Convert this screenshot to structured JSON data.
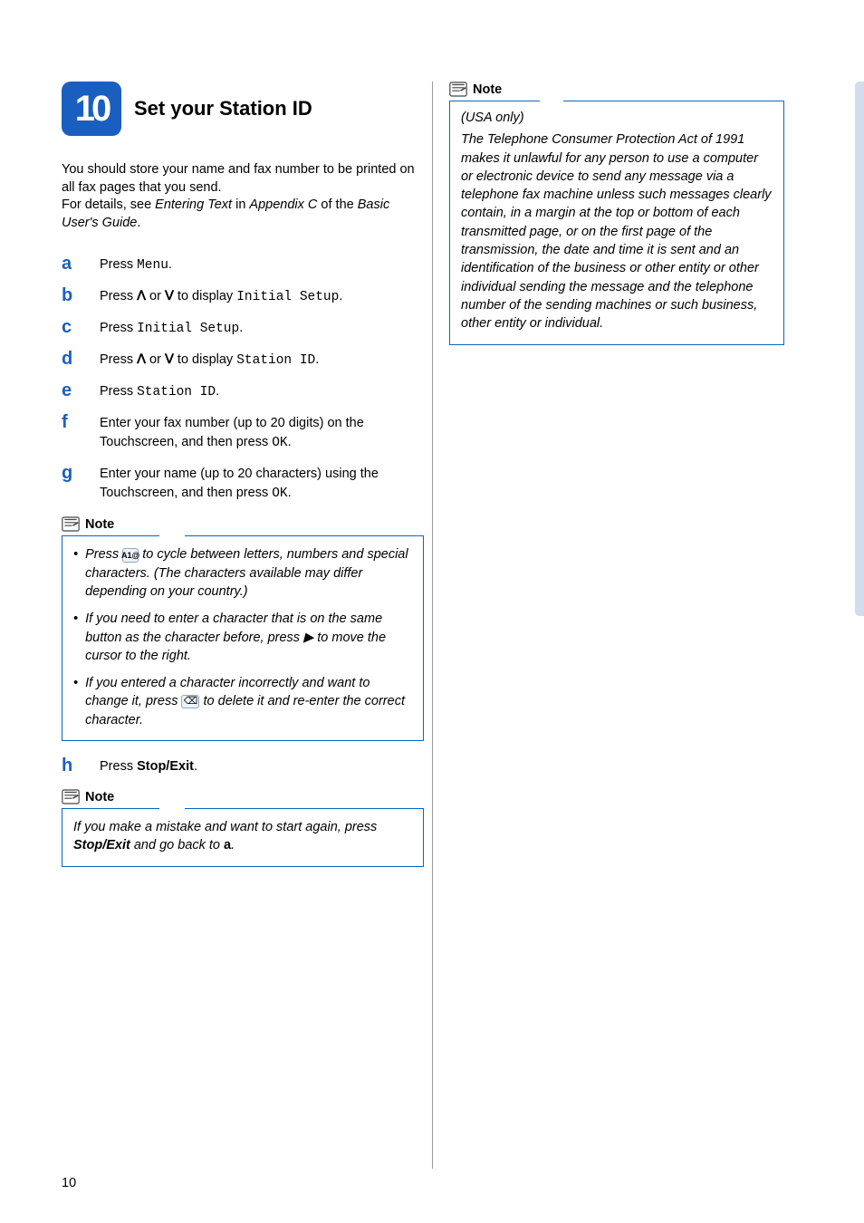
{
  "step_number": "10",
  "step_title": "Set your Station ID",
  "intro_l1": "You should store your name and fax number to be printed on all fax pages that you send.",
  "intro_l2a": "For details, see ",
  "intro_l2b": "Entering Text",
  "intro_l2c": " in ",
  "intro_l2d": "Appendix C",
  "intro_l2e": " of the ",
  "intro_l2f": "Basic User's Guide",
  "intro_l2g": ".",
  "steps": {
    "a": {
      "t1": "Press ",
      "m1": "Menu",
      "t2": "."
    },
    "b": {
      "t1": "Press ",
      "c1": "ᐱ",
      "t2": " or ",
      "c2": "ᐯ",
      "t3": " to display ",
      "m1": "Initial Setup",
      "t4": "."
    },
    "c": {
      "t1": "Press ",
      "m1": "Initial Setup",
      "t2": "."
    },
    "d": {
      "t1": "Press ",
      "c1": "ᐱ",
      "t2": " or ",
      "c2": "ᐯ",
      "t3": " to display ",
      "m1": "Station ID",
      "t4": "."
    },
    "e": {
      "t1": "Press ",
      "m1": "Station ID",
      "t2": "."
    },
    "f": {
      "t1": "Enter your fax number (up to 20 digits) on the Touchscreen, and then press ",
      "m1": "OK",
      "t2": "."
    },
    "g": {
      "t1": "Enter your name (up to 20 characters) using the Touchscreen, and then press ",
      "m1": "OK",
      "t2": "."
    },
    "h": {
      "t1": "Press ",
      "b1": "Stop/Exit",
      "t2": "."
    }
  },
  "note1_label": "Note",
  "note1_items": [
    {
      "pre": "Press ",
      "icon": "A1@",
      "post": " to cycle between letters, numbers and special characters. (The characters available may differ depending on your country.)"
    },
    {
      "pre": "If you need to enter a character that is on the same button as the character before, press ",
      "tri": "▶",
      "post": " to move the cursor to the right."
    },
    {
      "pre": "If you entered a character incorrectly and want to change it, press ",
      "del": "⌫",
      "post": " to delete it and re-enter the correct character."
    }
  ],
  "note2_label": "Note",
  "note2_t1": "If you make a mistake and want to start again, press ",
  "note2_b1": "Stop/Exit",
  "note2_t2": " and go back to ",
  "note2_ref": "a",
  "note2_t3": ".",
  "noteR_label": "Note",
  "noteR_t1": "(USA only)",
  "noteR_body": "The Telephone Consumer Protection Act of 1991 makes it unlawful for any person to use a computer or electronic device to send any message via a telephone fax machine unless such messages clearly contain, in a margin at the top or bottom of each transmitted page, or on the first page of the transmission, the date and time it is sent and an identification of the business or other entity or other individual sending the message and the telephone number of the sending machines or such business, other entity or individual.",
  "page_number": "10"
}
